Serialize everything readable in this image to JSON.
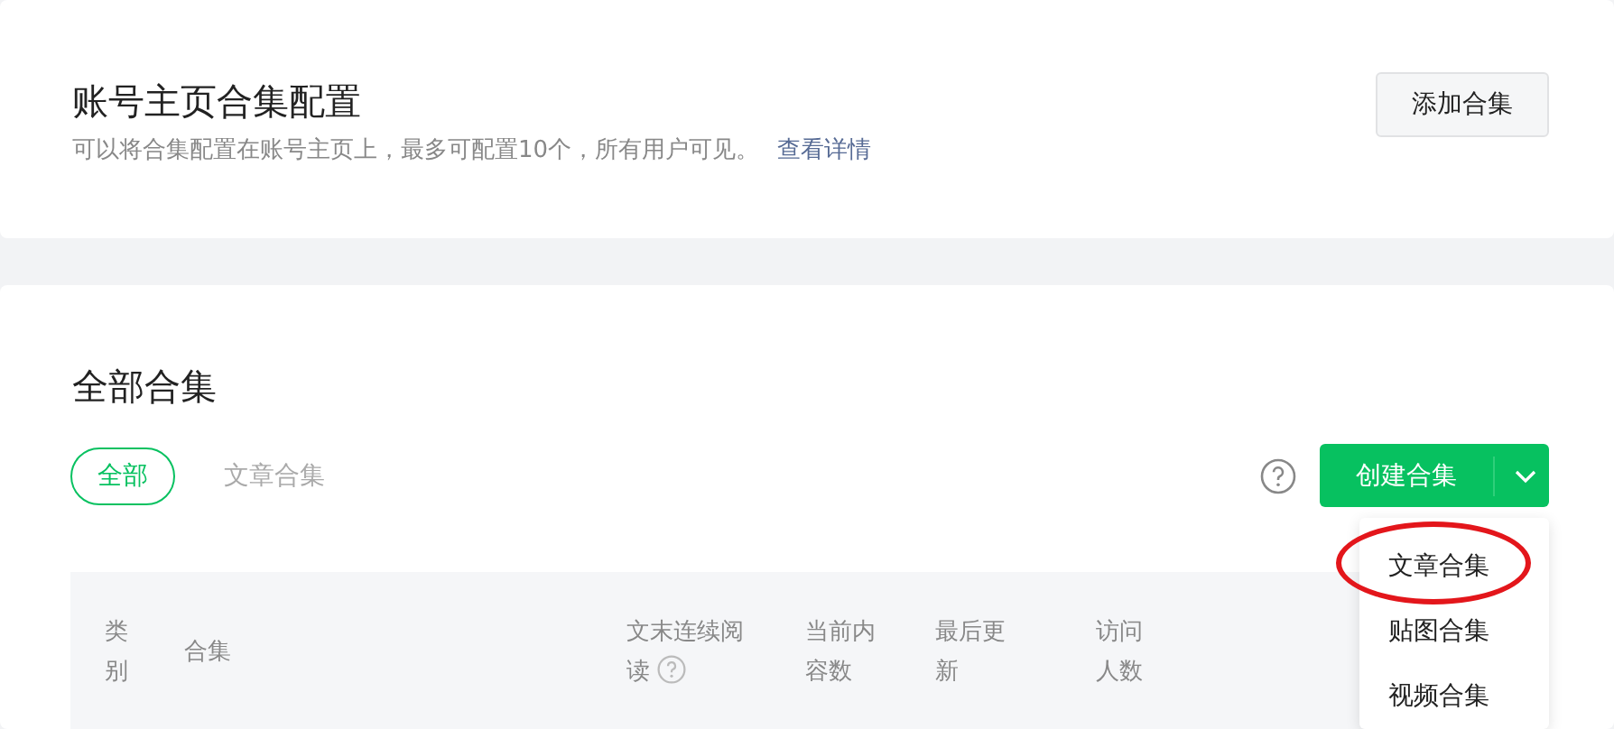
{
  "homepage_config": {
    "title": "账号主页合集配置",
    "description": "可以将合集配置在账号主页上，最多可配置10个，所有用户可见。",
    "details_link": "查看详情",
    "add_button": "添加合集"
  },
  "collections": {
    "title": "全部合集",
    "tabs": [
      {
        "label": "全部",
        "selected": true
      },
      {
        "label": "文章合集",
        "selected": false
      }
    ],
    "create_button": "创建合集",
    "create_menu": [
      {
        "label": "文章合集",
        "circled": true
      },
      {
        "label": "贴图合集",
        "circled": false
      },
      {
        "label": "视频合集",
        "circled": false
      }
    ],
    "table": {
      "columns": [
        {
          "label": "类别",
          "has_help": false
        },
        {
          "label": "合集",
          "has_help": false
        },
        {
          "label": "文末连续阅读",
          "has_help": true
        },
        {
          "label": "当前内容数",
          "has_help": false
        },
        {
          "label": "最后更新",
          "has_help": false
        },
        {
          "label": "访问人数",
          "has_help": false
        }
      ]
    }
  }
}
